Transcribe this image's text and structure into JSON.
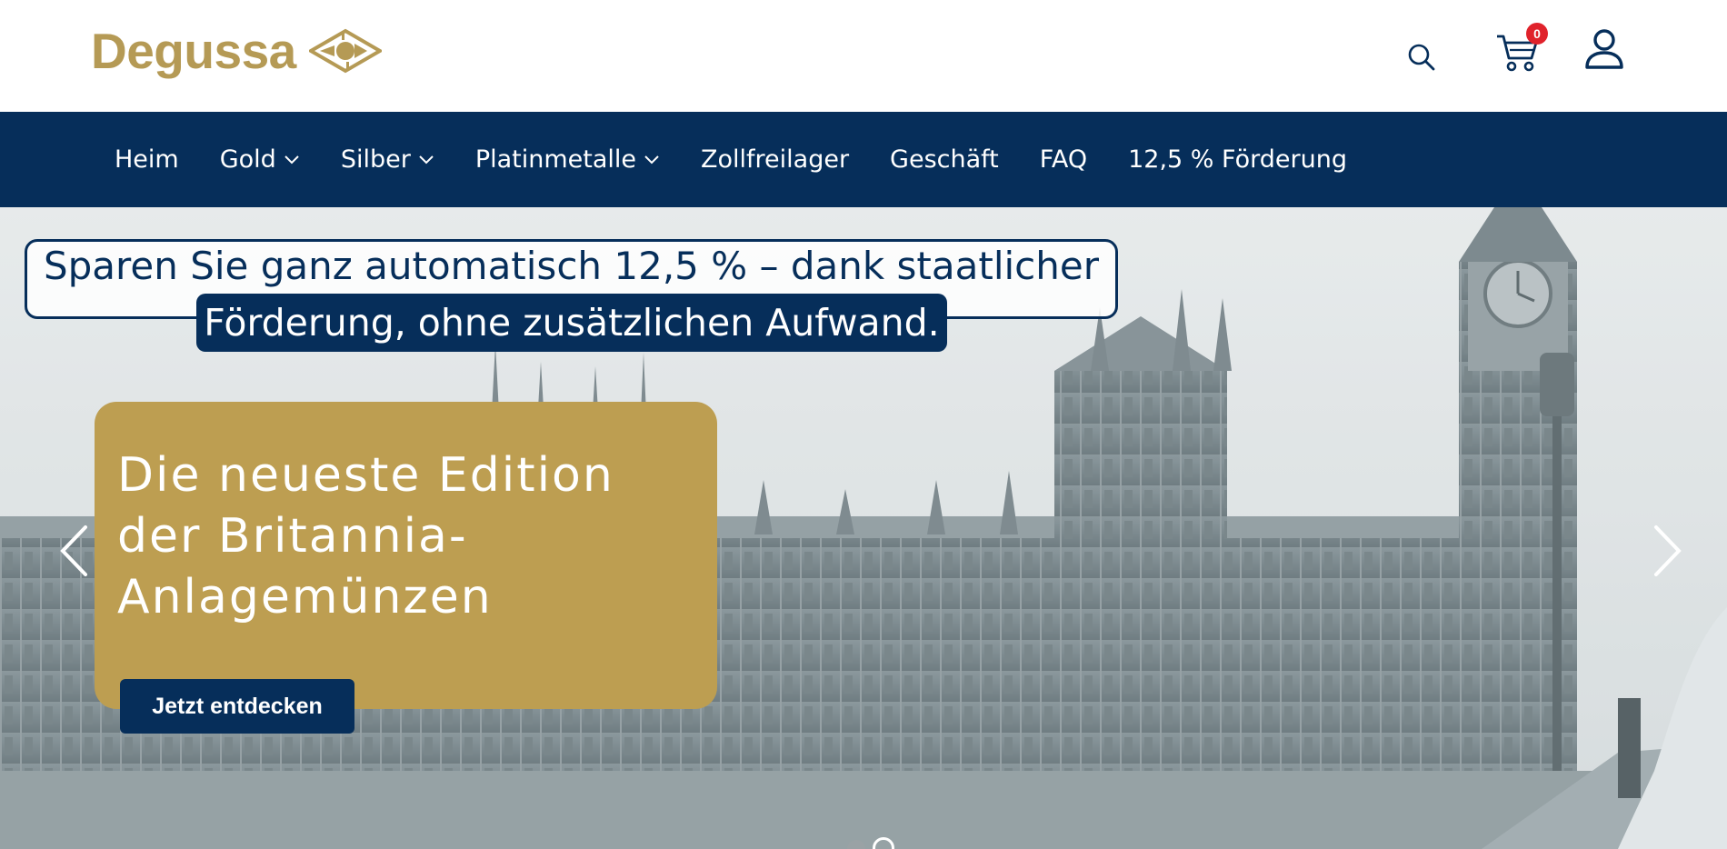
{
  "header": {
    "logo_text": "Degussa",
    "icons": [
      "search-icon",
      "cart-icon",
      "user-icon"
    ],
    "cart_count": "0"
  },
  "nav": {
    "items": [
      {
        "label": "Heim",
        "dropdown": false
      },
      {
        "label": "Gold",
        "dropdown": true
      },
      {
        "label": "Silber",
        "dropdown": true
      },
      {
        "label": "Platinmetalle",
        "dropdown": true
      },
      {
        "label": "Zollfreilager",
        "dropdown": false
      },
      {
        "label": "Geschäft",
        "dropdown": false
      },
      {
        "label": "FAQ",
        "dropdown": false
      },
      {
        "label": "12,5 % Förderung",
        "dropdown": false
      }
    ]
  },
  "hero": {
    "promo_line1": "Sparen Sie ganz automatisch 12,5 % – dank staatlicher",
    "promo_line2": "Förderung, ohne zusätzlichen Aufwand.",
    "title": "Die neueste Edition der Britannia-Anlagemünzen",
    "cta_label": "Jetzt entdecken",
    "slide_count": 2,
    "active_slide": 2
  },
  "colors": {
    "brand_gold": "#b59a55",
    "card_gold": "#bd9e51",
    "navy": "#062e5a",
    "badge_red": "#e0222b"
  }
}
